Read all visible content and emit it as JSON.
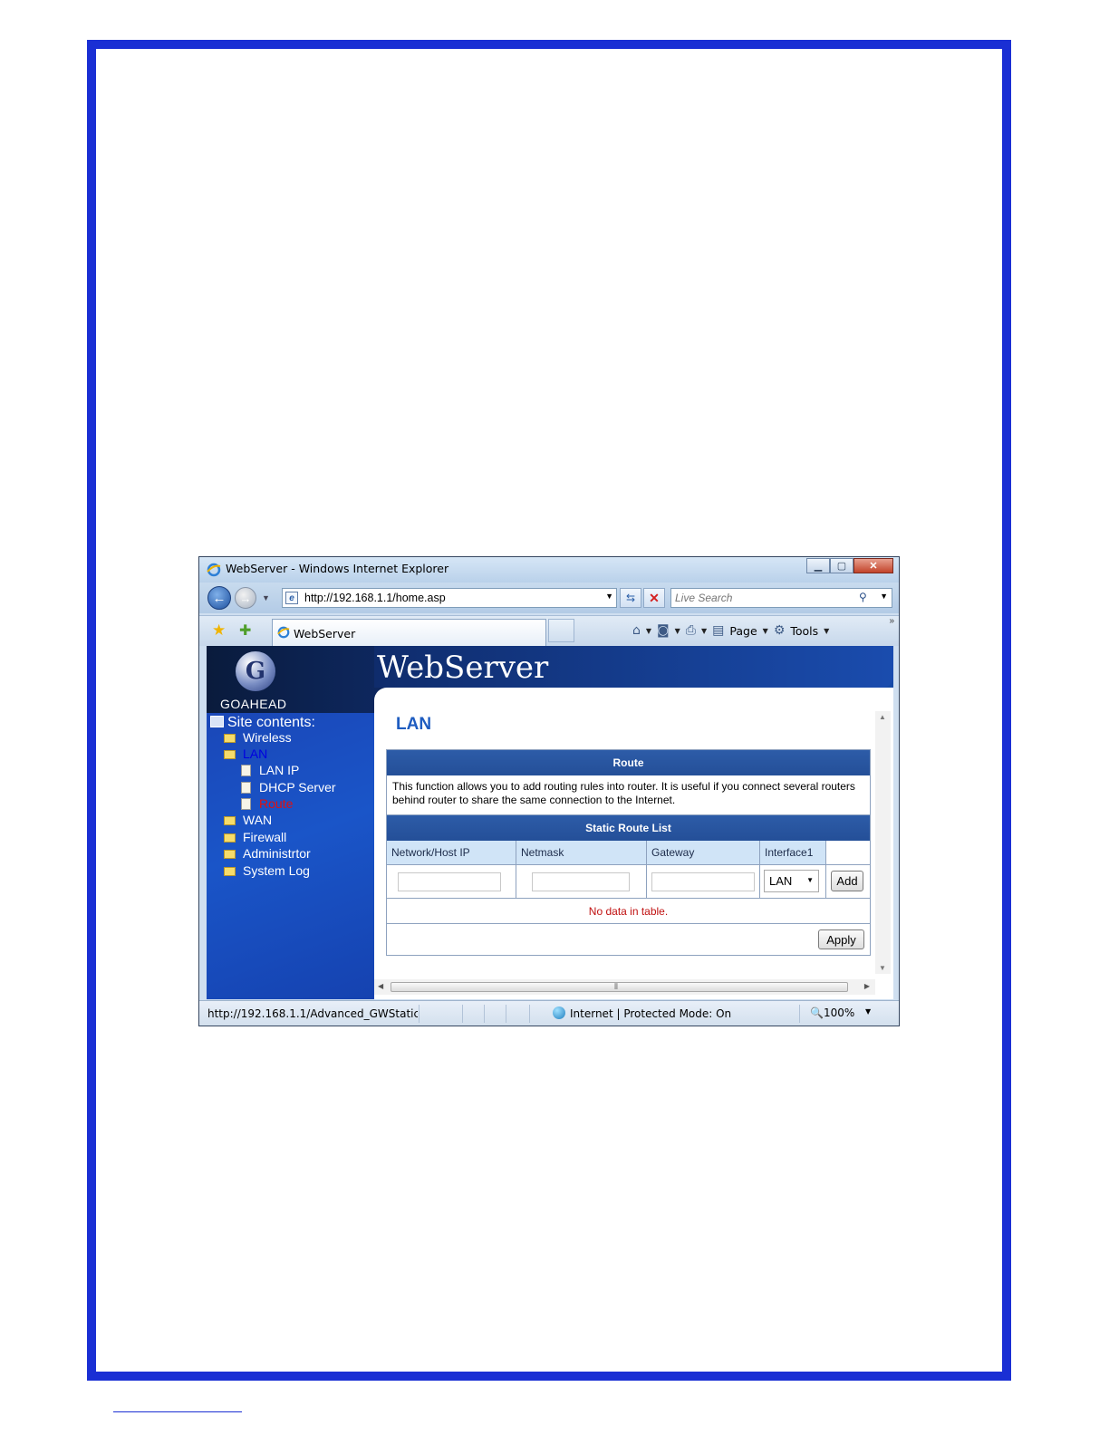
{
  "browser": {
    "window_title": "WebServer - Windows Internet Explorer",
    "address_url": "http://192.168.1.1/home.asp",
    "search_placeholder": "Live Search",
    "tab_title": "WebServer",
    "commands": {
      "page": "Page",
      "tools": "Tools"
    },
    "status_url": "http://192.168.1.1/Advanced_GWStaticRou",
    "status_zone": "Internet | Protected Mode: On",
    "zoom": "100%"
  },
  "site": {
    "brand": "WebServer",
    "logo_text": "GOAHEAD",
    "sidebar_heading": "Site contents:",
    "tree": {
      "wireless": "Wireless",
      "lan": "LAN",
      "lan_ip": "LAN IP",
      "dhcp_server": "DHCP Server",
      "route": "Route",
      "wan": "WAN",
      "firewall": "Firewall",
      "administrator": "Administrtor",
      "system_log": "System Log"
    }
  },
  "main": {
    "page_title": "LAN",
    "route_header": "Route",
    "description": "This function allows you to add routing rules into router. It is useful if you connect several routers behind router to share the same connection to the Internet.",
    "static_route_header": "Static Route List",
    "columns": [
      "Network/Host IP",
      "Netmask",
      "Gateway",
      "Interface1"
    ],
    "interface_selected": "LAN",
    "add_label": "Add",
    "empty_message": "No data in table.",
    "apply_label": "Apply"
  },
  "colors": {
    "page_border": "#1a2fd4",
    "sidebar_blue": "#1a55c8",
    "header_bar": "#2d5ca8",
    "title_blue": "#1e5cc0",
    "alert_red": "#c01010"
  }
}
